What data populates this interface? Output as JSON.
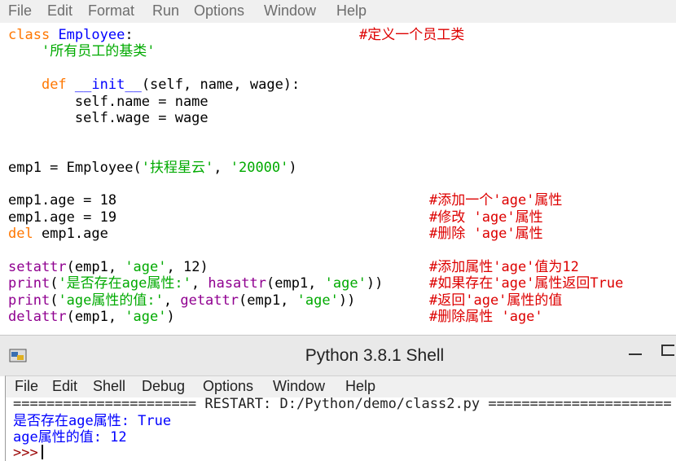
{
  "editor_menu": [
    "File",
    "Edit",
    "Format",
    "Run",
    "Options",
    "Window",
    "Help"
  ],
  "code": {
    "l1_kw": "class",
    "l1_name": "Employee",
    "l1_rest": ":",
    "l1_comment": "#定义一个员工类",
    "l2_doc": "'所有员工的基类'",
    "l4_kw": "def",
    "l4_name": "__init__",
    "l4_rest": "(self, name, wage):",
    "l5": "self.name = name",
    "l6": "self.wage = wage",
    "l9_a": "emp1 = Employee(",
    "l9_s1": "'扶程星云'",
    "l9_b": ", ",
    "l9_s2": "'20000'",
    "l9_c": ")",
    "l11": "emp1.age = 18",
    "l11_comment": "#添加一个'age'属性",
    "l12": "emp1.age = 19",
    "l12_comment": "#修改 'age'属性",
    "l13_kw": "del",
    "l13_rest": " emp1.age",
    "l13_comment": "#删除 'age'属性",
    "l15_fn": "setattr",
    "l15_a": "(emp1, ",
    "l15_s": "'age'",
    "l15_b": ", 12)",
    "l15_comment": "#添加属性'age'值为12",
    "l16_fn": "print",
    "l16_a": "(",
    "l16_s1": "'是否存在age属性:'",
    "l16_b": ", ",
    "l16_fn2": "hasattr",
    "l16_c": "(emp1, ",
    "l16_s2": "'age'",
    "l16_d": "))",
    "l16_comment": "#如果存在'age'属性返回True",
    "l17_fn": "print",
    "l17_a": "(",
    "l17_s1": "'age属性的值:'",
    "l17_b": ", ",
    "l17_fn2": "getattr",
    "l17_c": "(emp1, ",
    "l17_s2": "'age'",
    "l17_d": "))",
    "l17_comment": "#返回'age'属性的值",
    "l18_fn": "delattr",
    "l18_a": "(emp1, ",
    "l18_s": "'age'",
    "l18_b": ")",
    "l18_comment": "#删除属性 'age'"
  },
  "shell": {
    "title": "Python 3.8.1 Shell",
    "menu": [
      "File",
      "Edit",
      "Shell",
      "Debug",
      "Options",
      "Window",
      "Help"
    ],
    "restart_line": "====================== RESTART: D:/Python/demo/class2.py ======================",
    "out1": "是否存在age属性: True",
    "out2": "age属性的值: 12",
    "prompt": ">>>"
  },
  "colors": {
    "keyword": "#ff7700",
    "builtin": "#900090",
    "string": "#00aa00",
    "definition": "#0000ff",
    "comment": "#dd0000",
    "output": "#0000ff",
    "prompt": "#990000"
  }
}
